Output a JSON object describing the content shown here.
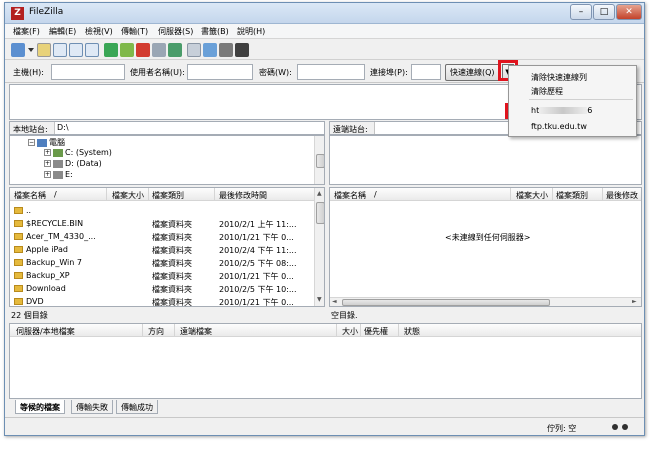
{
  "window": {
    "title": "FileZilla",
    "icon_label": "Z",
    "controls": {
      "minimize": "–",
      "maximize": "□",
      "close": "✕"
    }
  },
  "menu": [
    "檔案(F)",
    "編輯(E)",
    "檢視(V)",
    "傳輸(T)",
    "伺服器(S)",
    "書籤(B)",
    "說明(H)"
  ],
  "quickconnect": {
    "host_label": "主機(H):",
    "host_value": "",
    "user_label": "使用者名稱(U):",
    "user_value": "",
    "password_label": "密碼(W):",
    "password_value": "",
    "port_label": "連接埠(P):",
    "port_value": "",
    "button_label": "快速連線(Q)",
    "dropdown_glyph": "▼",
    "menu": {
      "clear_history": "清除快速連線列",
      "clear_history_list": "清除歷程",
      "history_item_1_prefix": "ht",
      "history_item_1_suffix": "6",
      "history_item_2": "ftp.tku.edu.tw"
    }
  },
  "local": {
    "site_label": "本地站台:",
    "site_path": "D:\\",
    "tree": [
      {
        "toggle": "⊟",
        "label": "電腦"
      },
      {
        "toggle": "⊞",
        "label": "C: (System)"
      },
      {
        "toggle": "⊞",
        "label": "D: (Data)"
      },
      {
        "toggle": "⊞",
        "label": "E:"
      }
    ],
    "columns": {
      "name": "檔案名稱",
      "sort_glyph": "/",
      "size": "檔案大小",
      "type": "檔案類別",
      "modified": "最後修改時間"
    },
    "files": [
      {
        "name": "..",
        "size": "",
        "type": "",
        "modified": ""
      },
      {
        "name": "$RECYCLE.BIN",
        "size": "",
        "type": "檔案資料夾",
        "modified": "2010/2/1 上午 11:..."
      },
      {
        "name": "Acer_TM_4330_...",
        "size": "",
        "type": "檔案資料夾",
        "modified": "2010/1/21 下午 0..."
      },
      {
        "name": "Apple iPad",
        "size": "",
        "type": "檔案資料夾",
        "modified": "2010/2/4 下午 11:..."
      },
      {
        "name": "Backup_Win 7",
        "size": "",
        "type": "檔案資料夾",
        "modified": "2010/2/5 下午 08:..."
      },
      {
        "name": "Backup_XP",
        "size": "",
        "type": "檔案資料夾",
        "modified": "2010/1/21 下午 0..."
      },
      {
        "name": "Download",
        "size": "",
        "type": "檔案資料夾",
        "modified": "2010/2/5 下午 10:..."
      },
      {
        "name": "DVD",
        "size": "",
        "type": "檔案資料夾",
        "modified": "2010/1/21 下午 0..."
      }
    ],
    "status": "22 個目錄"
  },
  "remote": {
    "site_label": "遠端站台:",
    "site_path": "",
    "columns": {
      "name": "檔案名稱",
      "sort_glyph": "/",
      "size": "檔案大小",
      "type": "檔案類別",
      "modified": "最後修改"
    },
    "empty_message": "<未連線到任何伺服器>",
    "status": "空目錄."
  },
  "queue": {
    "columns": {
      "server_local": "伺服器/本地檔案",
      "direction": "方向",
      "remote_file": "遠端檔案",
      "size": "大小",
      "priority": "優先權",
      "status": "狀態"
    },
    "tabs": [
      "等候的檔案",
      "傳輸失敗",
      "傳輸成功"
    ],
    "status_bar": "佇列: 空"
  },
  "colors": {
    "highlight": "#e0141e",
    "folder": "#e5b93c",
    "titlebar": "#c4d6ec"
  }
}
